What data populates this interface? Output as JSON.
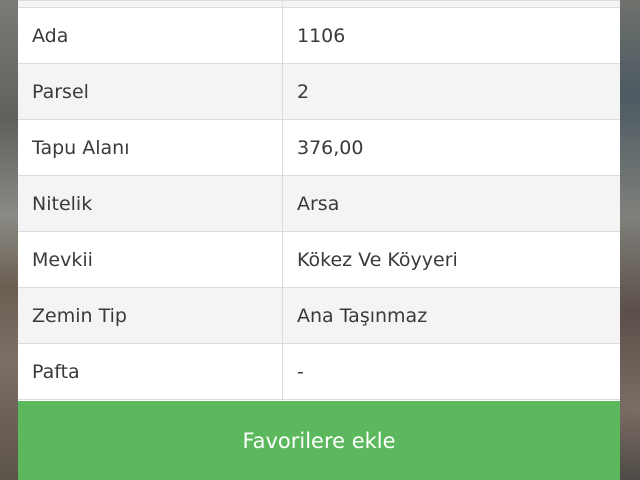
{
  "details": {
    "rows": [
      {
        "label": "Ada",
        "value": "1106"
      },
      {
        "label": "Parsel",
        "value": "2"
      },
      {
        "label": "Tapu Alanı",
        "value": "376,00"
      },
      {
        "label": "Nitelik",
        "value": "Arsa"
      },
      {
        "label": "Mevkii",
        "value": "Kökez Ve Köyyeri"
      },
      {
        "label": "Zemin Tip",
        "value": "Ana Taşınmaz"
      },
      {
        "label": "Pafta",
        "value": "-"
      }
    ]
  },
  "actions": {
    "favorite_label": "Favorilere ekle",
    "favorite_color": "#5cb85c"
  },
  "colors": {
    "row_shaded": "#f4f4f4",
    "row_plain": "#ffffff",
    "text": "#3a3a3a",
    "border": "#dcdcdc"
  }
}
